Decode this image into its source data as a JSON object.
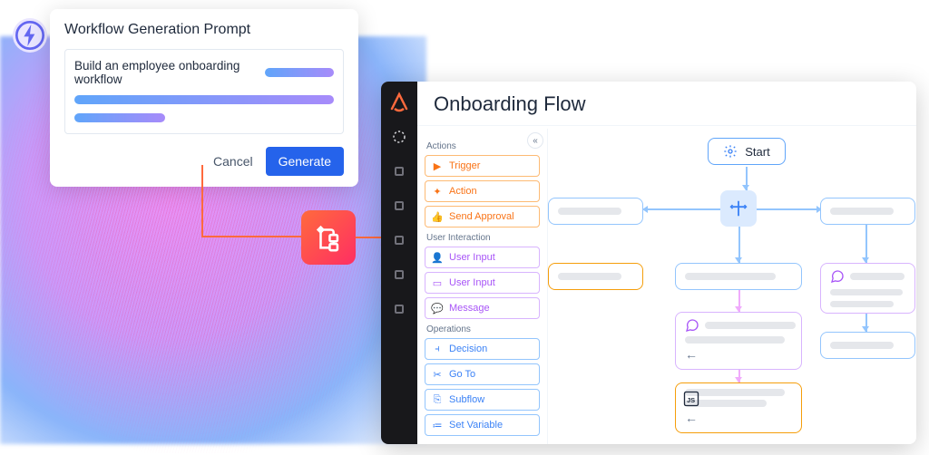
{
  "prompt": {
    "title": "Workflow Generation Prompt",
    "input_text": "Build an employee onboarding workflow",
    "cancel_label": "Cancel",
    "generate_label": "Generate"
  },
  "editor": {
    "title": "Onboarding Flow",
    "start_label": "Start",
    "palette": {
      "sections": {
        "actions": "Actions",
        "user_interaction": "User Interaction",
        "operations": "Operations"
      },
      "items": {
        "trigger": "Trigger",
        "action": "Action",
        "send_approval": "Send Approval",
        "user_input_1": "User Input",
        "user_input_2": "User Input",
        "message": "Message",
        "decision": "Decision",
        "go_to": "Go To",
        "subflow": "Subflow",
        "set_variable": "Set Variable"
      }
    }
  },
  "icons": {
    "lightning": "lightning-icon",
    "diagram": "diagram-icon",
    "start": "gear-icon",
    "decision": "signpost-icon",
    "chat": "chat-icon",
    "js": "js-icon"
  },
  "colors": {
    "accent_blue": "#2563eb",
    "accent_orange": "#ff6a3d",
    "accent_purple": "#a855f7"
  }
}
